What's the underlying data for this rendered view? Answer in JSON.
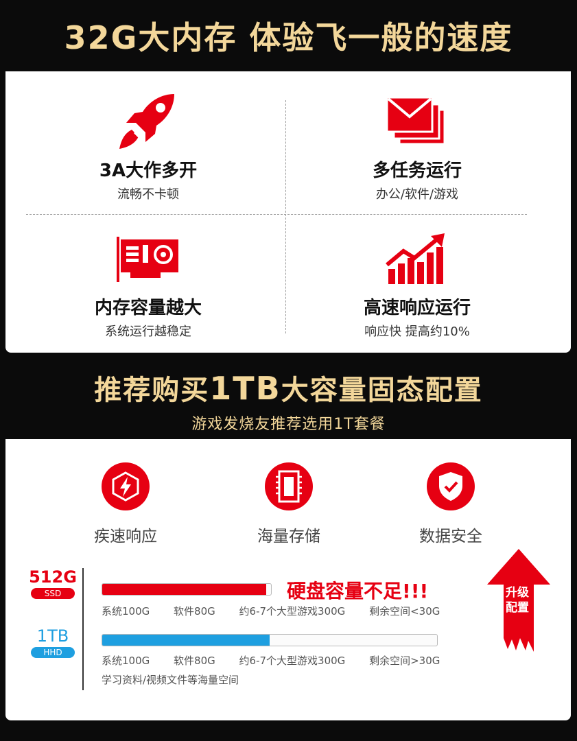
{
  "section1": {
    "title": "32G大内存 体验飞一般的速度",
    "features": [
      {
        "title": "3A大作多开",
        "subtitle": "流畅不卡顿",
        "icon": "rocket-icon"
      },
      {
        "title": "多任务运行",
        "subtitle": "办公/软件/游戏",
        "icon": "stacked-envelopes-icon"
      },
      {
        "title": "内存容量越大",
        "subtitle": "系统运行越稳定",
        "icon": "memory-card-icon"
      },
      {
        "title": "高速响应运行",
        "subtitle": "响应快 提高约10%",
        "icon": "rising-bar-chart-icon"
      }
    ]
  },
  "section2": {
    "title_pre": "推荐购买",
    "title_bold": "1TB",
    "title_post": "大容量固态配置",
    "subtitle": "游戏发烧友推荐选用1T套餐",
    "benefits": [
      {
        "label": "疾速响应",
        "icon": "lightning-badge-icon"
      },
      {
        "label": "海量存储",
        "icon": "storage-chip-icon"
      },
      {
        "label": "数据安全",
        "icon": "shield-check-icon"
      }
    ],
    "options": [
      {
        "capacity": "512G",
        "type": "SSD",
        "color": "#e60012",
        "fill_fraction": 0.97,
        "fill_color": "#e60012",
        "details": [
          "系统100G",
          "软件80G",
          "约6-7个大型游戏300G",
          "剩余空间<30G"
        ]
      },
      {
        "capacity": "1TB",
        "type": "HHD",
        "color": "#1e9fe0",
        "fill_fraction": 0.5,
        "fill_color": "#1e9fe0",
        "details": [
          "系统100G",
          "软件80G",
          "约6-7个大型游戏300G",
          "剩余空间>30G"
        ],
        "extra": "学习资料/视频文件等海量空间"
      }
    ],
    "warning": "硬盘容量不足!!!",
    "upgrade_line1": "升级",
    "upgrade_line2": "配置"
  },
  "colors": {
    "accent": "#e60012",
    "gold": "#f3d79a",
    "blue": "#1e9fe0",
    "background": "#0b0b0b"
  }
}
